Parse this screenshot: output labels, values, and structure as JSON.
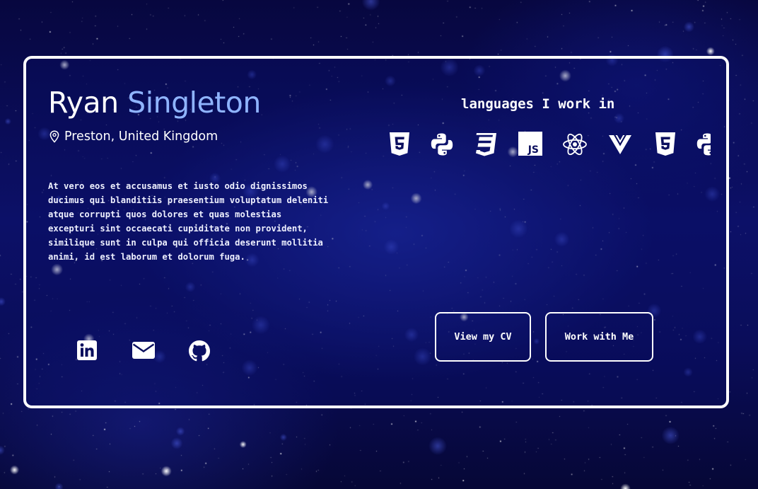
{
  "profile": {
    "first_name": "Ryan",
    "last_name": "Singleton",
    "location": "Preston, United Kingdom",
    "bio": "At vero eos et accusamus et iusto odio dignissimos ducimus qui blanditiis praesentium voluptatum deleniti atque corrupti quos dolores et quas molestias excepturi sint occaecati cupiditate non provident, similique sunt in culpa qui officia deserunt mollitia animi, id est laborum et dolorum fuga."
  },
  "languages": {
    "title": "languages I work in",
    "icons": [
      "html5-icon",
      "python-icon",
      "css3-icon",
      "javascript-icon",
      "react-icon",
      "vue-icon",
      "html5-icon",
      "python-icon"
    ],
    "js_badge_text": "JS"
  },
  "socials": [
    "linkedin-icon",
    "email-icon",
    "github-icon"
  ],
  "actions": {
    "cv_label": "View my CV",
    "work_label": "Work with Me"
  },
  "colors": {
    "last_name_accent": "#8fb4ff",
    "card_border": "#ffffff",
    "background_deep": "#07073f",
    "background_mid": "#0c1068"
  }
}
